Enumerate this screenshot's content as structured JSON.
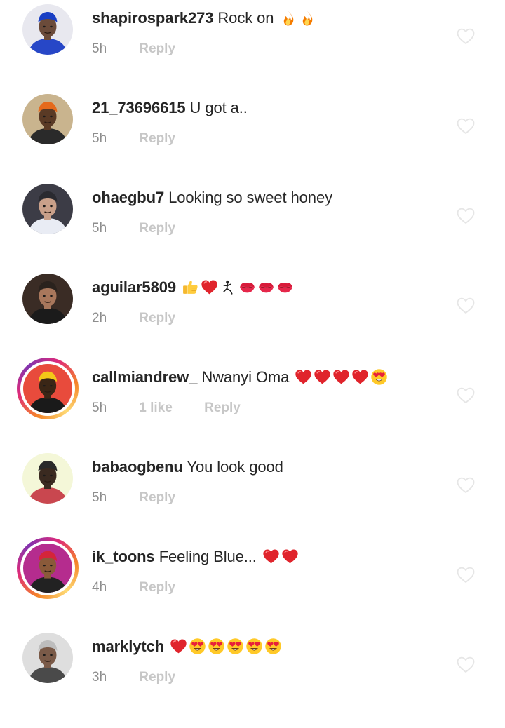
{
  "comments": [
    {
      "username": "shapirospark273",
      "text": "Rock on",
      "time": "5h",
      "likes": "",
      "reply": "Reply",
      "emoji": [
        "fire",
        "fire"
      ],
      "story_ring": false,
      "avatar": {
        "bg": "#e8e8ef",
        "skin": "#6b4b3a",
        "shirt": "#2747c7",
        "hat": "#1a3fc4"
      }
    },
    {
      "username": "21_73696615",
      "text": "U got a..",
      "time": "5h",
      "likes": "",
      "reply": "Reply",
      "emoji": [],
      "story_ring": false,
      "avatar": {
        "bg": "#c9b48e",
        "skin": "#5a3a25",
        "shirt": "#2a2a2a",
        "hat": "#e56a1c"
      }
    },
    {
      "username": "ohaegbu7",
      "text": "Looking so sweet honey",
      "time": "5h",
      "likes": "",
      "reply": "Reply",
      "emoji": [],
      "story_ring": false,
      "avatar": {
        "bg": "#3c3c46",
        "skin": "#c9a08a",
        "shirt": "#e9ecf4",
        "hat": "#2a2a30"
      }
    },
    {
      "username": "aguilar5809",
      "text": "",
      "time": "2h",
      "likes": "",
      "reply": "Reply",
      "emoji": [
        "thumbs-up",
        "red-heart",
        "figure",
        "kiss-mark",
        "kiss-mark",
        "kiss-mark"
      ],
      "story_ring": false,
      "avatar": {
        "bg": "#3a2c25",
        "skin": "#a8775c",
        "shirt": "#1b1b1b",
        "hat": "#2a221d"
      }
    },
    {
      "username": "callmiandrew_",
      "text": "Nwanyi Oma",
      "time": "5h",
      "likes": "1 like",
      "reply": "Reply",
      "emoji": [
        "red-heart",
        "red-heart",
        "red-heart",
        "red-heart",
        "heart-eyes"
      ],
      "story_ring": true,
      "avatar": {
        "bg": "#e84b3c",
        "skin": "#3a2616",
        "shirt": "#1a1a1a",
        "hat": "#f3c718"
      }
    },
    {
      "username": "babaogbenu",
      "text": "You look good",
      "time": "5h",
      "likes": "",
      "reply": "Reply",
      "emoji": [],
      "story_ring": false,
      "avatar": {
        "bg": "#f4f7d8",
        "skin": "#3a2a20",
        "shirt": "#c9474f",
        "hat": "#2a2a2a"
      }
    },
    {
      "username": "ik_toons",
      "text": "Feeling Blue...",
      "time": "4h",
      "likes": "",
      "reply": "Reply",
      "emoji": [
        "red-heart",
        "red-heart"
      ],
      "story_ring": true,
      "avatar": {
        "bg": "#b52c8e",
        "skin": "#8a5a3a",
        "shirt": "#222222",
        "hat": "#d4253a"
      }
    },
    {
      "username": "marklytch",
      "text": "",
      "time": "3h",
      "likes": "",
      "reply": "Reply",
      "emoji": [
        "red-heart",
        "heart-eyes",
        "heart-eyes",
        "heart-eyes",
        "heart-eyes",
        "heart-eyes"
      ],
      "story_ring": false,
      "avatar": {
        "bg": "#dedede",
        "skin": "#7a5a48",
        "shirt": "#4a4a4a",
        "hat": "#bdbdbd"
      }
    }
  ],
  "colors": {
    "username": "#262626",
    "meta": "#8e8e8e",
    "action": "#c7c7c7",
    "like_outline": "#e6e6e6"
  }
}
